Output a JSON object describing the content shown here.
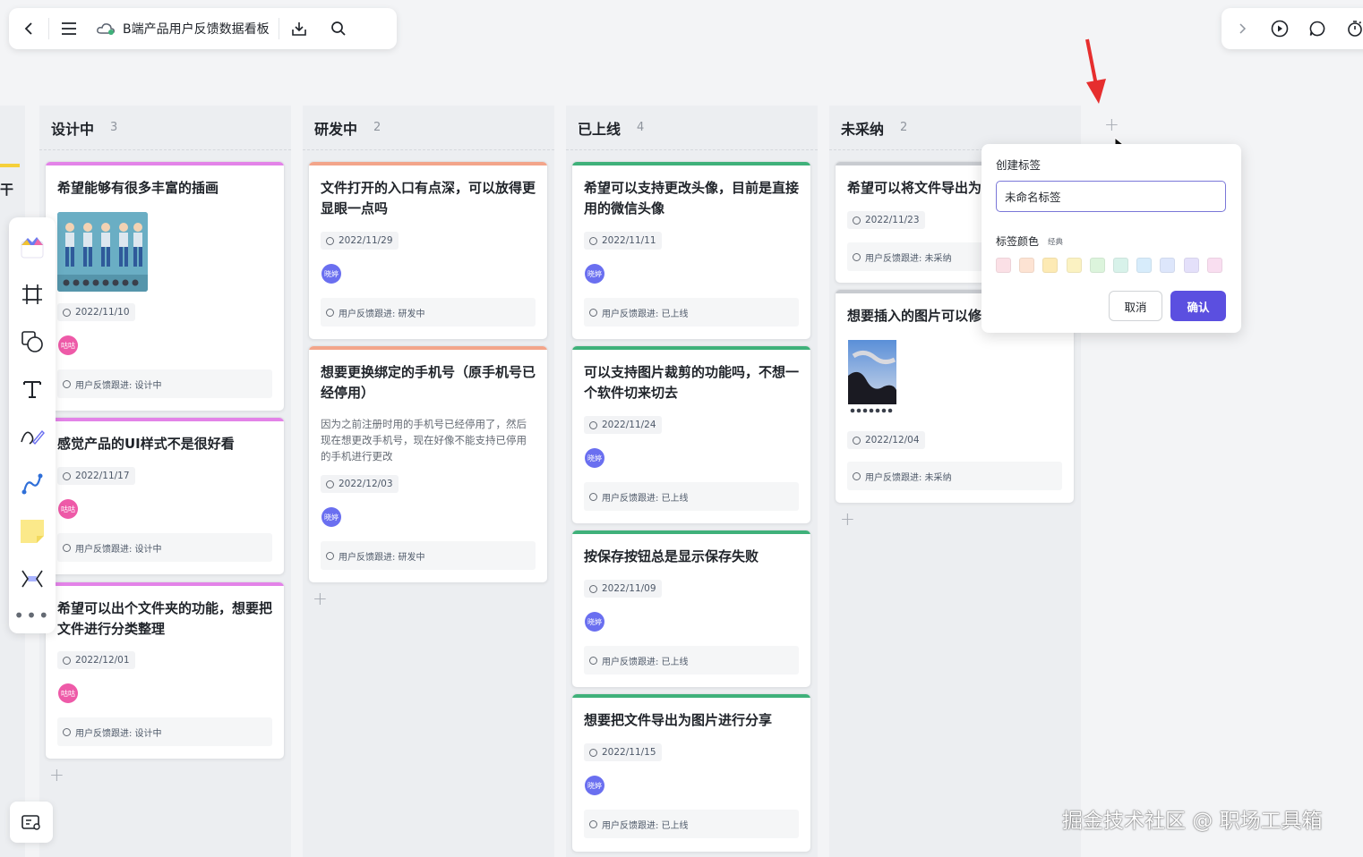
{
  "header": {
    "title": "B端产品用户反馈数据看板",
    "icons": [
      "back-icon",
      "menu-icon",
      "cloud-icon",
      "download-icon",
      "search-icon"
    ],
    "right_icons": [
      "chevron-right-icon",
      "play-icon",
      "comment-icon",
      "timer-icon"
    ]
  },
  "left_edge_text": "干",
  "columns": [
    {
      "name": "设计中",
      "count": "3",
      "cards": [
        {
          "title": "希望能够有很多丰富的插画",
          "date": "2022/11/10",
          "avatar": "咕咕",
          "status": "用户反馈跟进: 设计中"
        },
        {
          "title": "感觉产品的UI样式不是很好看",
          "date": "2022/11/17",
          "avatar": "咕咕",
          "status": "用户反馈跟进: 设计中"
        },
        {
          "title": "希望可以出个文件夹的功能，想要把文件进行分类整理",
          "date": "2022/12/01",
          "avatar": "咕咕",
          "status": "用户反馈跟进: 设计中"
        }
      ]
    },
    {
      "name": "研发中",
      "count": "2",
      "cards": [
        {
          "title": "文件打开的入口有点深，可以放得更显眼一点吗",
          "date": "2022/11/29",
          "avatar": "晓婷",
          "status": "用户反馈跟进: 研发中"
        },
        {
          "title": "想要更换绑定的手机号（原手机号已经停用）",
          "desc": "因为之前注册时用的手机号已经停用了，然后现在想更改手机号，现在好像不能支持已停用的手机进行更改",
          "date": "2022/12/03",
          "avatar": "晓婷",
          "status": "用户反馈跟进: 研发中"
        }
      ]
    },
    {
      "name": "已上线",
      "count": "4",
      "cards": [
        {
          "title": "希望可以支持更改头像，目前是直接用的微信头像",
          "date": "2022/11/11",
          "avatar": "晓婷",
          "status": "用户反馈跟进: 已上线"
        },
        {
          "title": "可以支持图片裁剪的功能吗，不想一个软件切来切去",
          "date": "2022/11/24",
          "avatar": "晓婷",
          "status": "用户反馈跟进: 已上线"
        },
        {
          "title": "按保存按钮总是显示保存失败",
          "date": "2022/11/09",
          "avatar": "晓婷",
          "status": "用户反馈跟进: 已上线"
        },
        {
          "title": "想要把文件导出为图片进行分享",
          "date": "2022/11/15",
          "avatar": "晓婷",
          "status": "用户反馈跟进: 已上线"
        }
      ]
    },
    {
      "name": "未采纳",
      "count": "2",
      "cards": [
        {
          "title": "希望可以将文件导出为",
          "date": "2022/11/23",
          "status": "用户反馈跟进: 未采纳"
        },
        {
          "title": "想要插入的图片可以修",
          "date": "2022/12/04",
          "status": "用户反馈跟进: 未采纳"
        }
      ]
    }
  ],
  "popup": {
    "title": "创建标签",
    "input_value": "未命名标签",
    "color_label": "标签颜色",
    "color_sub": "经典",
    "swatches": [
      "#fbe0e6",
      "#fde3d3",
      "#fdeab4",
      "#fbf2c2",
      "#dcf4dc",
      "#d8f2ea",
      "#d7ecfb",
      "#dde6fb",
      "#e4e0fa",
      "#f9def0"
    ],
    "cancel": "取消",
    "confirm": "确认"
  },
  "colors": {
    "design": "#e383e8",
    "dev": "#f3a58a",
    "online": "#3fb17a",
    "rejected": "#c8cbd0",
    "avatar_pink": "#ee5aa8",
    "avatar_blue": "#6a6ff0",
    "accent": "#5b4fe0"
  },
  "watermark": "掘金技术社区 @ 职场工具箱"
}
